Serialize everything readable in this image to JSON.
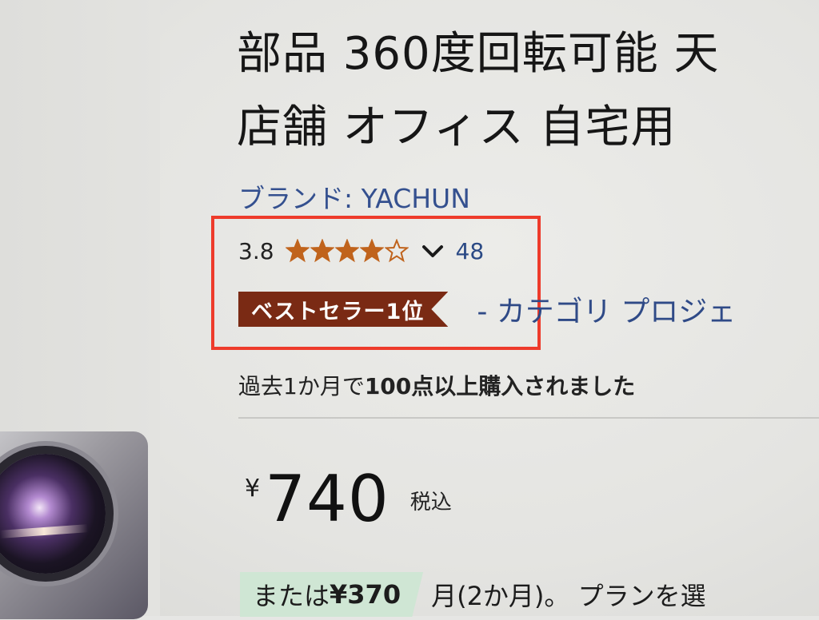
{
  "product": {
    "title_line1": "部品 360度回転可能 天",
    "title_line2": "店舗 オフィス 自宅用 ",
    "brand_label": "ブランド: YACHUN"
  },
  "rating": {
    "value": "3.8",
    "stars_filled": 3.8,
    "stars_total": 5,
    "review_count": "48",
    "star_color": "#c0631c"
  },
  "badge": {
    "label": "ベストセラー1位",
    "color": "#7a2a14",
    "category_text": "- カテゴリ プロジェ"
  },
  "purchase_note": {
    "prefix": "過去1か月で",
    "emphasis": "100点以上購入されました"
  },
  "price": {
    "currency": "¥",
    "amount": "740",
    "tax_label": "税込"
  },
  "installment": {
    "prefix": "または",
    "amount": "¥370",
    "rest": "月(2か月)。 プランを選"
  },
  "highlight": {
    "color": "#ee3b2b"
  }
}
